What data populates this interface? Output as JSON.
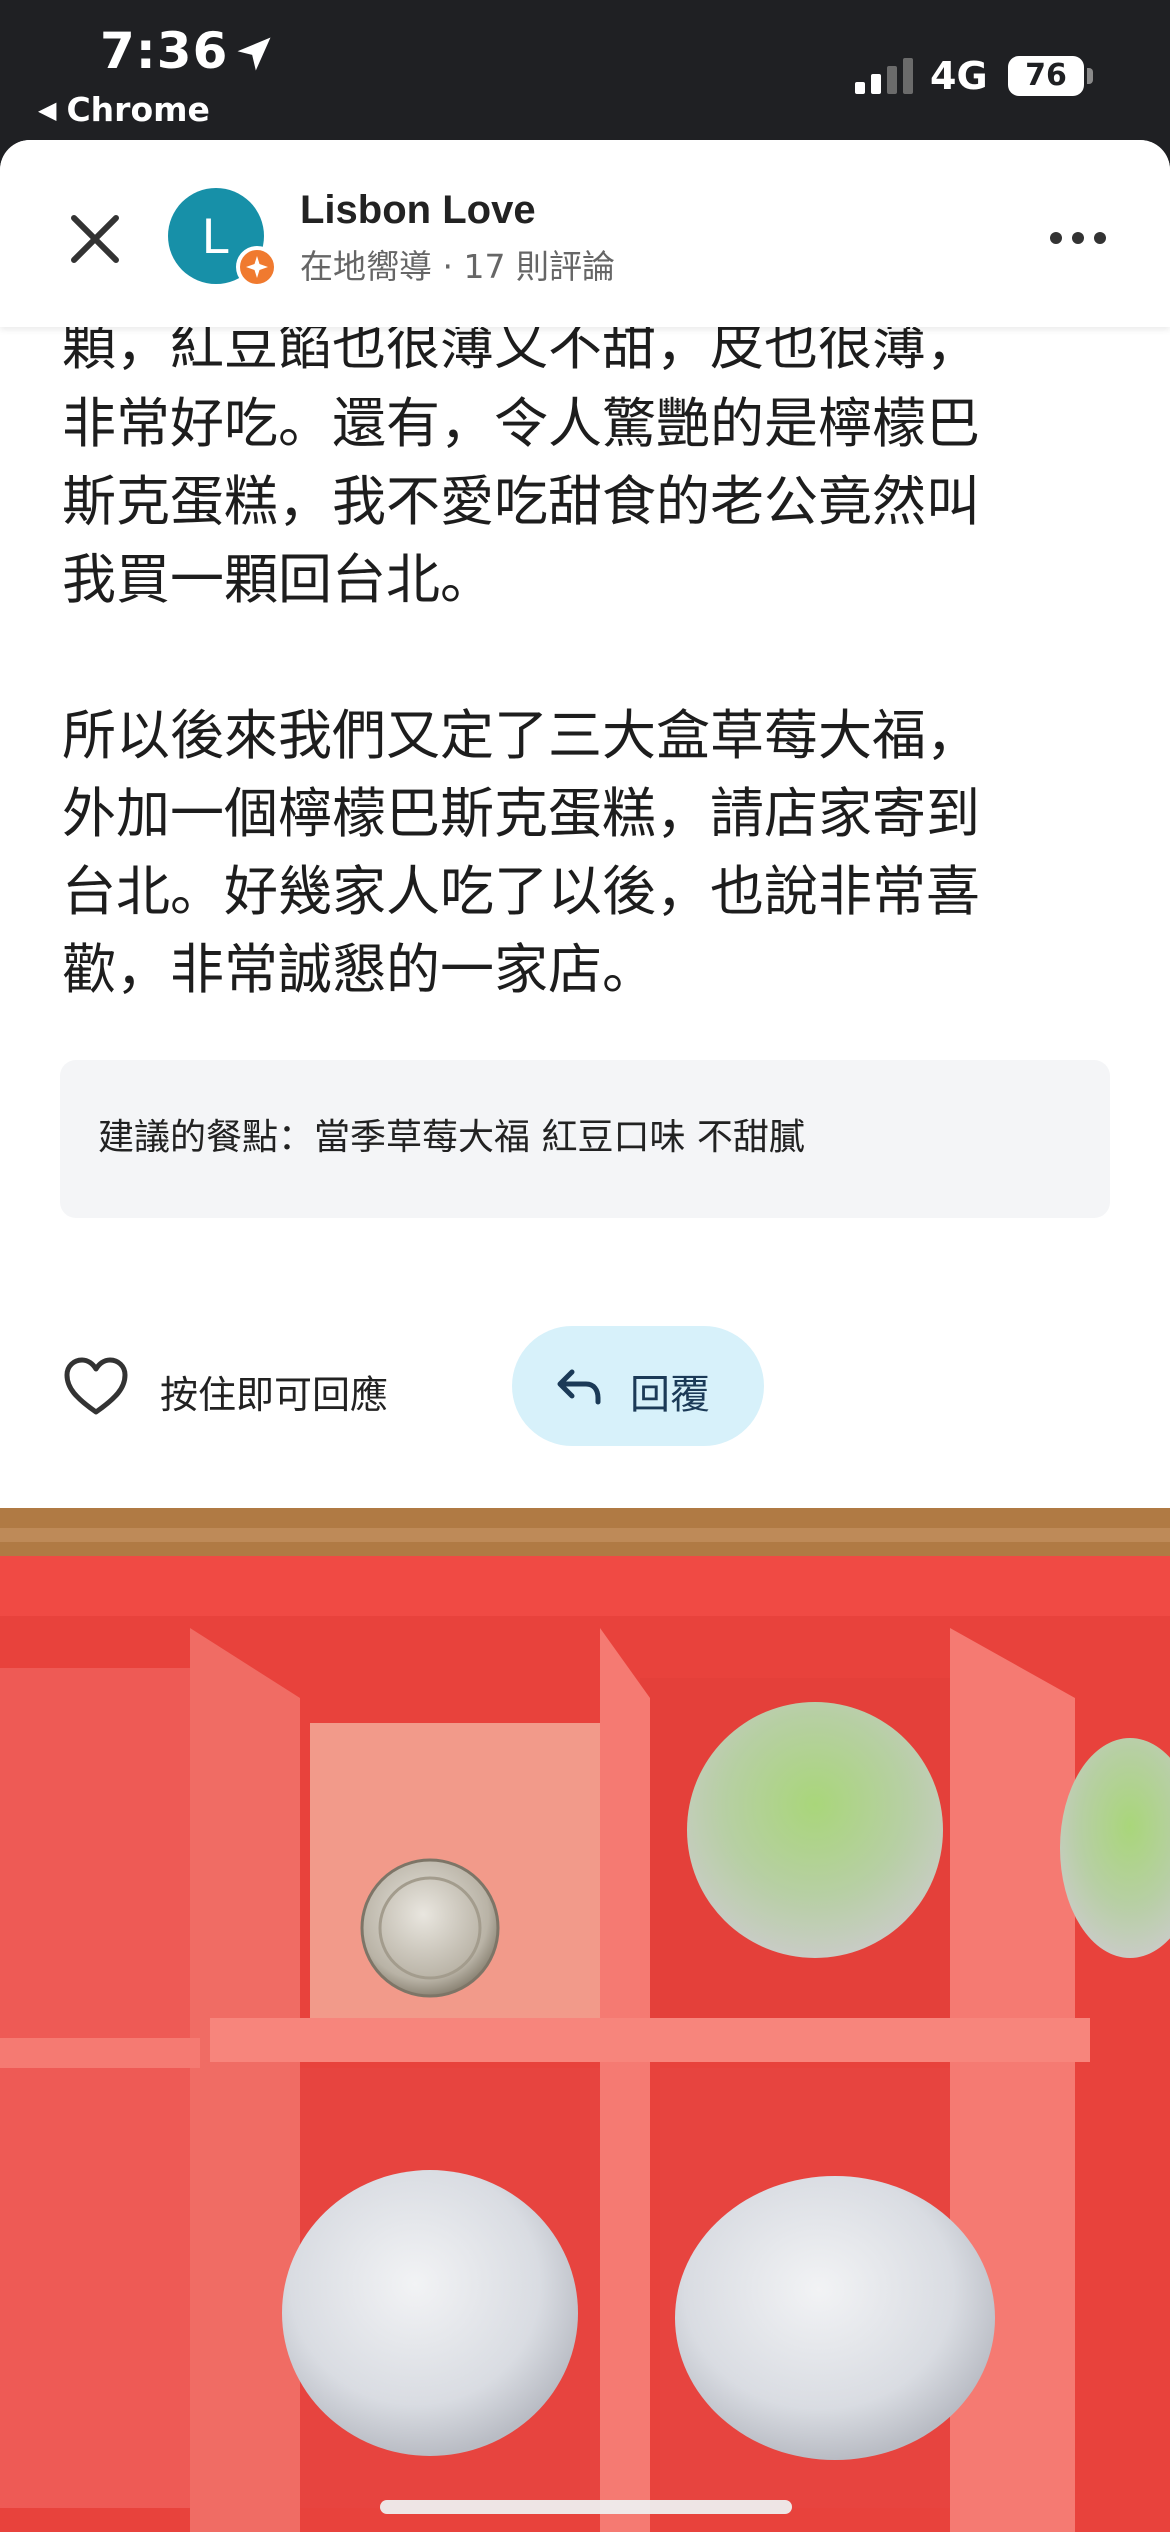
{
  "status_bar": {
    "time": "7:36",
    "back_app": "Chrome",
    "network": "4G",
    "battery": "76"
  },
  "header": {
    "avatar_letter": "L",
    "author_name": "Lisbon Love",
    "author_meta": "在地嚮導 · 17 則評論",
    "icons": [
      "close-icon",
      "more-icon",
      "local-guide-badge-icon"
    ]
  },
  "review": {
    "paragraph_1": "顆，紅豆餡也很薄又不甜，皮也很薄，\n非常好吃。還有，令人驚艷的是檸檬巴\n斯克蛋糕，我不愛吃甜食的老公竟然叫\n我買一顆回台北。",
    "paragraph_2": "所以後來我們又定了三大盒草莓大福，\n外加一個檸檬巴斯克蛋糕，請店家寄到\n台北。好幾家人吃了以後，也說非常喜\n歡，非常誠懇的一家店。"
  },
  "suggested": {
    "text": "建議的餐點：當季草莓大福 紅豆口味 不甜膩"
  },
  "actions": {
    "like_label": "按住即可回應",
    "reply_label": "回覆"
  },
  "colors": {
    "avatar": "#1790a8",
    "badge": "#f07a2f",
    "reply_bg": "#d7f1fa",
    "box_red": "#e8423c"
  }
}
